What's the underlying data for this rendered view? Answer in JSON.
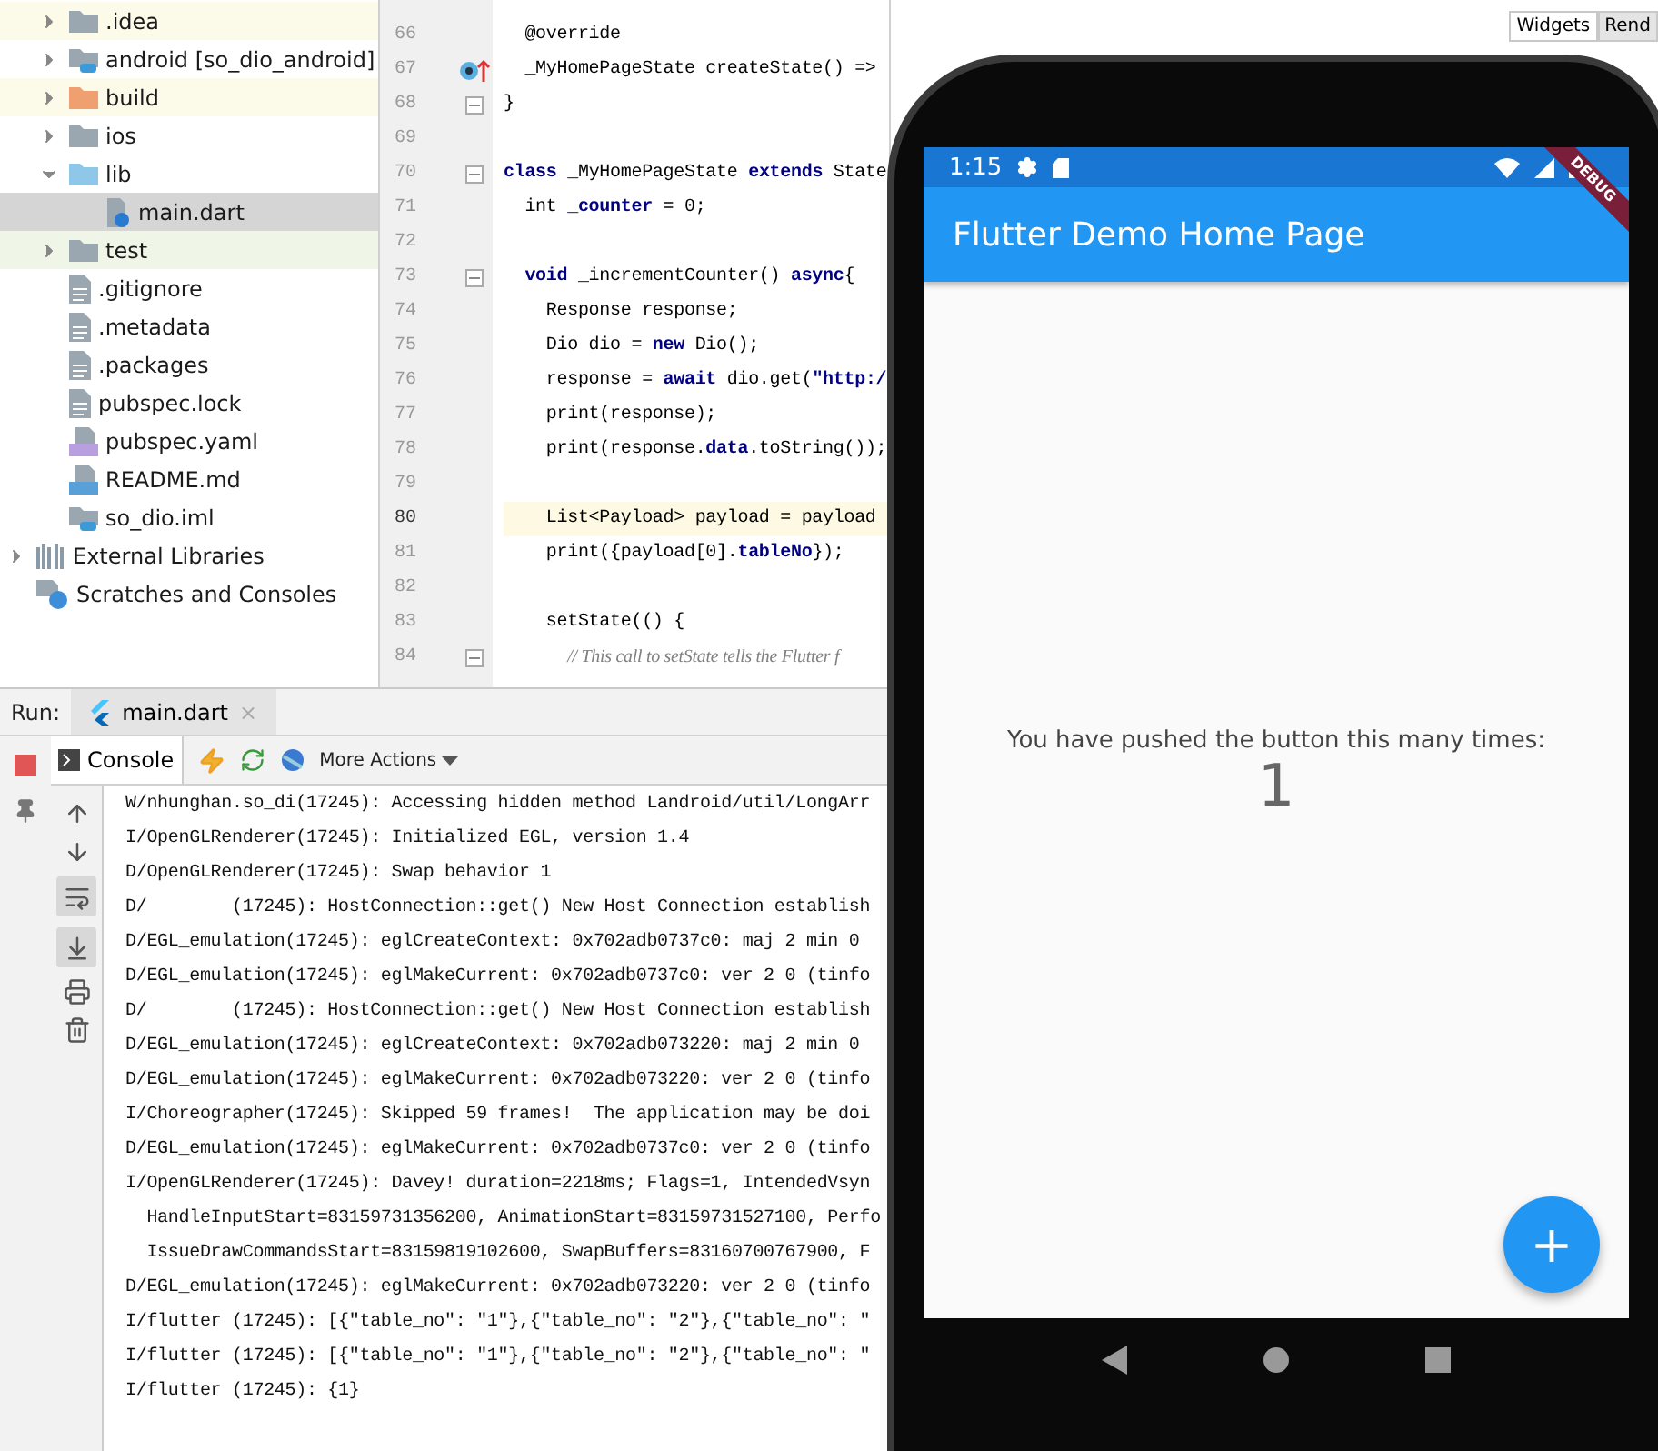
{
  "ide": {
    "project_items": [
      {
        "label": ".idea",
        "kind": "folder",
        "expanded": false,
        "selected": false,
        "color": "#fcfae8"
      },
      {
        "label": "android [so_dio_android]",
        "kind": "module",
        "expanded": false,
        "selected": false,
        "color": "#ffffff"
      },
      {
        "label": "build",
        "kind": "orange-folder",
        "expanded": false,
        "selected": false,
        "color": "#fcfae8"
      },
      {
        "label": "ios",
        "kind": "folder",
        "expanded": false,
        "selected": false,
        "color": "#ffffff"
      },
      {
        "label": "lib",
        "kind": "blue-folder",
        "expanded": true,
        "selected": false,
        "color": "#ffffff",
        "children": [
          {
            "label": "main.dart",
            "kind": "dart",
            "selected": true
          }
        ]
      },
      {
        "label": "test",
        "kind": "folder",
        "expanded": false,
        "selected": false,
        "color": "#eff6e8"
      },
      {
        "label": ".gitignore",
        "kind": "file",
        "selected": false,
        "color": "#ffffff"
      },
      {
        "label": ".metadata",
        "kind": "file",
        "selected": false,
        "color": "#ffffff"
      },
      {
        "label": ".packages",
        "kind": "file",
        "selected": false,
        "color": "#ffffff"
      },
      {
        "label": "pubspec.lock",
        "kind": "file",
        "selected": false,
        "color": "#ffffff"
      },
      {
        "label": "pubspec.yaml",
        "kind": "yaml",
        "selected": false,
        "color": "#ffffff"
      },
      {
        "label": "README.md",
        "kind": "markdown",
        "selected": false,
        "color": "#ffffff"
      },
      {
        "label": "so_dio.iml",
        "kind": "module",
        "selected": false,
        "color": "#ffffff"
      }
    ],
    "root_items": [
      {
        "label": "External Libraries",
        "kind": "libraries",
        "expanded": false,
        "selected": false,
        "color": "#ffffff"
      },
      {
        "label": "Scratches and Consoles",
        "kind": "scratches",
        "selected": false,
        "color": "#ffffff"
      }
    ],
    "editor": {
      "lines": [
        {
          "number": "66",
          "code": "  @override",
          "kind": "plain",
          "current": false
        },
        {
          "number": "67",
          "code": "  _MyHomePageState createState() =>",
          "kind": "override",
          "current": false
        },
        {
          "number": "68",
          "code": "}",
          "kind": "fold",
          "current": false
        },
        {
          "number": "69",
          "kind": "plain",
          "current": false
        },
        {
          "number": "70",
          "code": "**class** _MyHomePageState **extends** State",
          "kind": "fold",
          "current": false
        },
        {
          "number": "71",
          "code": "  int **_counter** = 0;",
          "kind": "plain",
          "current": false
        },
        {
          "number": "72",
          "kind": "plain",
          "current": false
        },
        {
          "number": "73",
          "code": "  **void** _incrementCounter() **async**{",
          "kind": "fold",
          "current": false
        },
        {
          "number": "74",
          "code": "    Response response;",
          "kind": "plain",
          "current": false
        },
        {
          "number": "75",
          "code": "    Dio dio = **new** Dio();",
          "kind": "plain",
          "current": false
        },
        {
          "number": "76",
          "code": "    response = **await** dio.get(**\"http:/**",
          "kind": "plain",
          "current": false
        },
        {
          "number": "77",
          "code": "    print(response);",
          "kind": "plain",
          "current": false
        },
        {
          "number": "78",
          "code": "    print(response.**data**.toString());",
          "kind": "plain",
          "current": false
        },
        {
          "number": "79",
          "kind": "plain",
          "current": false
        },
        {
          "number": "80",
          "code": "    List<Payload> payload = payload",
          "kind": "plain",
          "current": true
        },
        {
          "number": "81",
          "code": "    print({payload[0].**tableNo**});",
          "kind": "plain",
          "current": false
        },
        {
          "number": "82",
          "kind": "plain",
          "current": false
        },
        {
          "number": "83",
          "code": "    setState(() {",
          "kind": "plain",
          "current": false
        },
        {
          "number": "84",
          "code": "      *// This call to setState tells the Flutter f*",
          "kind": "fold",
          "current": false
        }
      ]
    },
    "side_tabs": [
      {
        "label": "Widgets",
        "selected": true
      },
      {
        "label": "Rend",
        "selected": false
      }
    ],
    "run_panel": {
      "label": "Run:",
      "tab": {
        "label": "main.dart",
        "close": "×"
      },
      "console_tab": "Console",
      "more_actions": "More Actions",
      "log": [
        "W/nhunghan.so_di(17245): Accessing hidden method Landroid/util/LongArr",
        "I/OpenGLRenderer(17245): Initialized EGL, version 1.4",
        "D/OpenGLRenderer(17245): Swap behavior 1",
        "D/        (17245): HostConnection::get() New Host Connection establish",
        "D/EGL_emulation(17245): eglCreateContext: 0x702adb0737c0: maj 2 min 0",
        "D/EGL_emulation(17245): eglMakeCurrent: 0x702adb0737c0: ver 2 0 (tinfo",
        "D/        (17245): HostConnection::get() New Host Connection establish",
        "D/EGL_emulation(17245): eglCreateContext: 0x702adb073220: maj 2 min 0",
        "D/EGL_emulation(17245): eglMakeCurrent: 0x702adb073220: ver 2 0 (tinfo",
        "I/Choreographer(17245): Skipped 59 frames!  The application may be doi",
        "D/EGL_emulation(17245): eglMakeCurrent: 0x702adb0737c0: ver 2 0 (tinfo",
        "I/OpenGLRenderer(17245): Davey! duration=2218ms; Flags=1, IntendedVsyn",
        "  HandleInputStart=83159731356200, AnimationStart=83159731527100, Perfo",
        "  IssueDrawCommandsStart=83159819102600, SwapBuffers=83160700767900, F",
        "D/EGL_emulation(17245): eglMakeCurrent: 0x702adb073220: ver 2 0 (tinfo",
        "I/flutter (17245): [{\"table_no\": \"1\"},{\"table_no\": \"2\"},{\"table_no\": \"",
        "I/flutter (17245): [{\"table_no\": \"1\"},{\"table_no\": \"2\"},{\"table_no\": \"",
        "I/flutter (17245): {1}"
      ]
    }
  },
  "emulator": {
    "status_time": "1:15",
    "app_title": "Flutter Demo Home Page",
    "debug_banner": "DEBUG",
    "message": "You have pushed the button this many times:",
    "counter": "1",
    "fab": "+"
  }
}
